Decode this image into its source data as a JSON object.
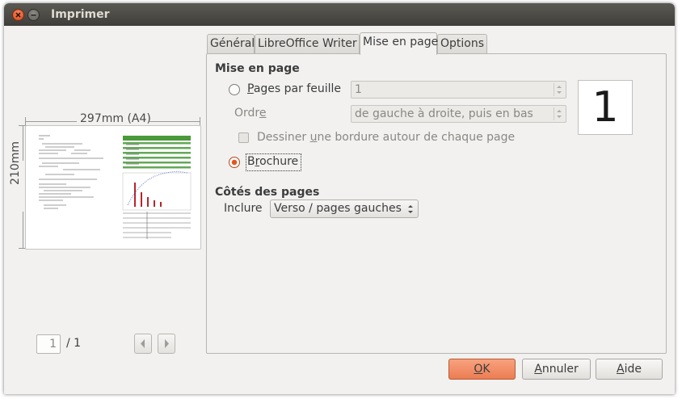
{
  "window": {
    "title": "Imprimer"
  },
  "preview": {
    "width_label": "297mm (A4)",
    "height_label": "210mm",
    "current_page": "1",
    "total_pages": "/ 1"
  },
  "tabs": [
    {
      "label": "Général"
    },
    {
      "label": "LibreOffice Writer"
    },
    {
      "label": "Mise en page",
      "active": true
    },
    {
      "label": "Options"
    }
  ],
  "layout_section": {
    "heading": "Mise en page",
    "pages_per_sheet": {
      "label_pre": "",
      "mnemonic": "P",
      "label_post": "ages par feuille",
      "value": "1",
      "selected": false
    },
    "order": {
      "label_pre": "Ordr",
      "mnemonic": "e",
      "label_post": "",
      "value": "de gauche à droite, puis en bas"
    },
    "border_checkbox": {
      "label_pre": "Dessiner ",
      "mnemonic": "u",
      "label_post": "ne bordure autour de chaque page",
      "checked": false
    },
    "brochure": {
      "label_pre": "B",
      "mnemonic": "r",
      "label_post": "ochure",
      "selected": true
    },
    "page_count_display": "1"
  },
  "sides_section": {
    "heading": "Côtés des pages",
    "include_label": "Inclure",
    "include_value": "Verso / pages gauches"
  },
  "buttons": {
    "ok": {
      "mnemonic": "O",
      "rest": "K"
    },
    "cancel": {
      "mnemonic": "A",
      "rest": "nnuler"
    },
    "help": {
      "mnemonic": "A",
      "rest": "ide"
    }
  },
  "colors": {
    "accent": "#e4561f",
    "titlebar": "#3f3e3a",
    "thumb_green": "#4a9a3a",
    "thumb_red": "#b8242a",
    "thumb_blue": "#3b55c0"
  }
}
